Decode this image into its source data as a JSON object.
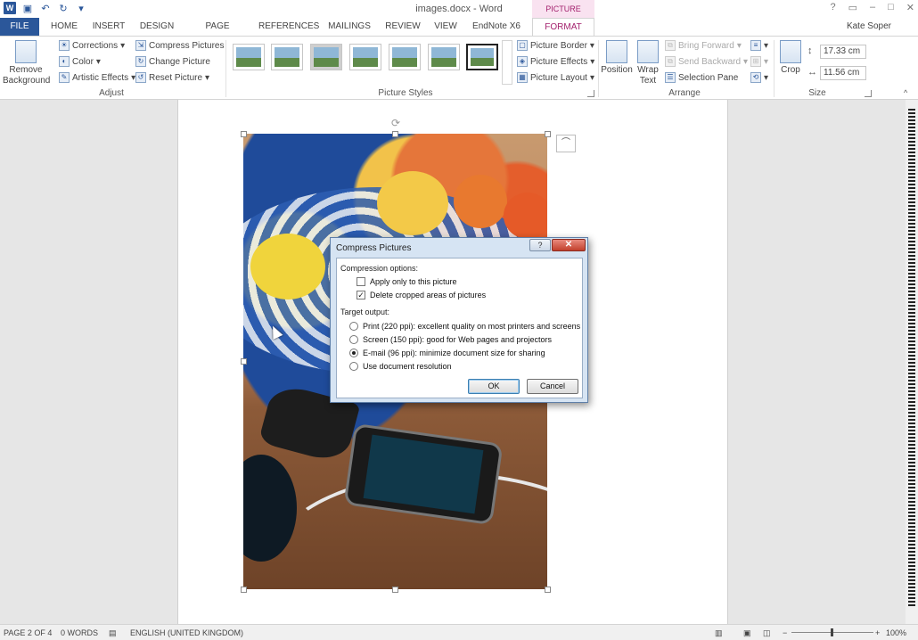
{
  "window": {
    "title": "images.docx - Word",
    "contextual_group": "PICTURE TOOLS",
    "user": "Kate Soper",
    "help": "?"
  },
  "tabs": [
    "FILE",
    "HOME",
    "INSERT",
    "DESIGN",
    "PAGE LAYOUT",
    "REFERENCES",
    "MAILINGS",
    "REVIEW",
    "VIEW",
    "EndNote X6",
    "FORMAT"
  ],
  "ribbon": {
    "adjust": {
      "remove_background": "Remove Background",
      "corrections": "Corrections",
      "color": "Color",
      "artistic_effects": "Artistic Effects",
      "compress_pictures": "Compress Pictures",
      "change_picture": "Change Picture",
      "reset_picture": "Reset Picture",
      "label": "Adjust"
    },
    "picture_styles": {
      "picture_border": "Picture Border",
      "picture_effects": "Picture Effects",
      "picture_layout": "Picture Layout",
      "label": "Picture Styles"
    },
    "arrange": {
      "position": "Position",
      "wrap_text": "Wrap Text",
      "bring_forward": "Bring Forward",
      "send_backward": "Send Backward",
      "selection_pane": "Selection Pane",
      "label": "Arrange"
    },
    "size": {
      "crop": "Crop",
      "height": "17.33 cm",
      "width": "11.56 cm",
      "label": "Size"
    }
  },
  "dialog": {
    "title": "Compress Pictures",
    "help": "?",
    "close": "✕",
    "compression_heading": "Compression options:",
    "apply_only": "Apply only to this picture",
    "apply_only_checked": false,
    "delete_cropped": "Delete cropped areas of pictures",
    "delete_cropped_checked": true,
    "target_heading": "Target output:",
    "options": [
      {
        "label": "Print (220 ppi): excellent quality on most printers and screens",
        "selected": false
      },
      {
        "label": "Screen (150 ppi): good for Web pages and projectors",
        "selected": false
      },
      {
        "label": "E-mail (96 ppi): minimize document size for sharing",
        "selected": true
      },
      {
        "label": "Use document resolution",
        "selected": false
      }
    ],
    "ok": "OK",
    "cancel": "Cancel"
  },
  "status": {
    "page": "PAGE 2 OF 4",
    "words": "0 WORDS",
    "language": "ENGLISH (UNITED KINGDOM)",
    "zoom": "100%",
    "zoom_minus": "−",
    "zoom_plus": "+"
  }
}
